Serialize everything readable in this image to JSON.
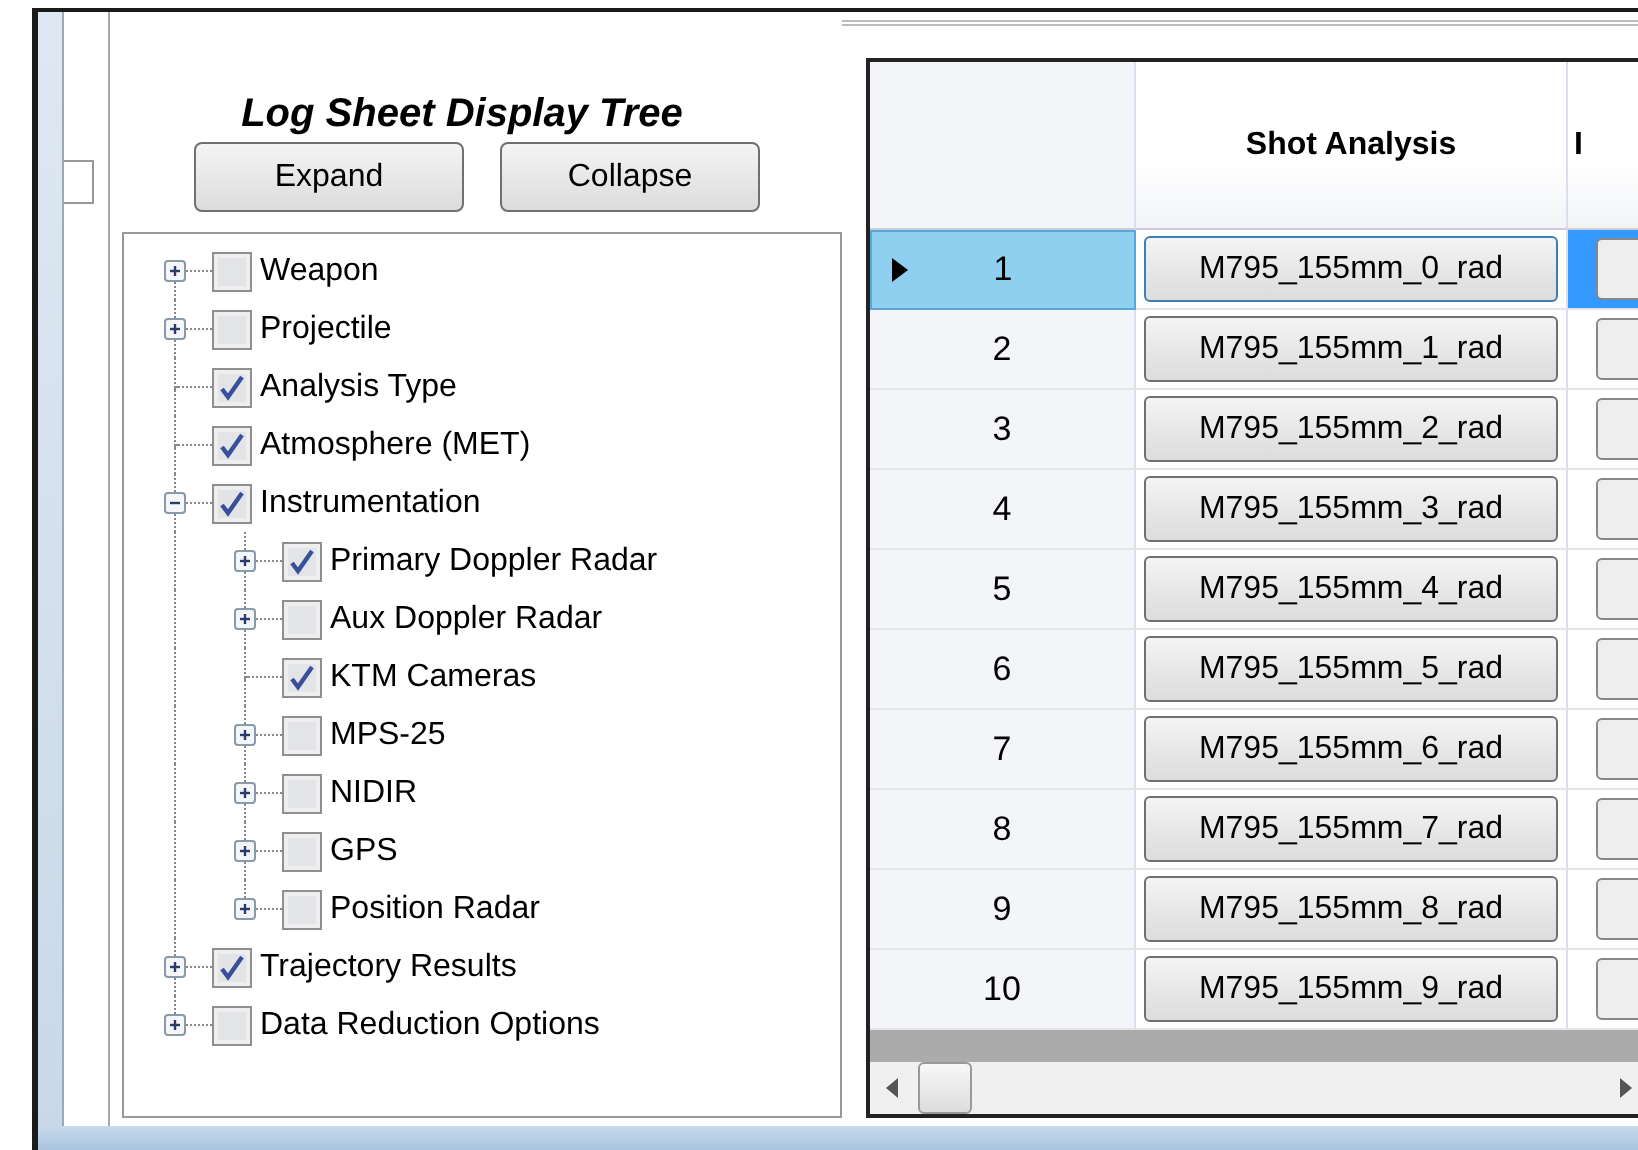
{
  "tree_panel": {
    "title": "Log Sheet Display Tree",
    "buttons": [
      "Expand",
      "Collapse"
    ],
    "tree": [
      {
        "label": "Weapon",
        "kind": "branch",
        "expanded": false,
        "checked": false
      },
      {
        "label": "Projectile",
        "kind": "branch",
        "expanded": false,
        "checked": false
      },
      {
        "label": "Analysis Type",
        "kind": "leaf",
        "checked": true
      },
      {
        "label": "Atmosphere (MET)",
        "kind": "leaf",
        "checked": true
      },
      {
        "label": "Instrumentation",
        "kind": "branch",
        "expanded": true,
        "checked": true,
        "children": [
          {
            "label": "Primary Doppler Radar",
            "kind": "branch",
            "expanded": false,
            "checked": true
          },
          {
            "label": "Aux Doppler Radar",
            "kind": "branch",
            "expanded": false,
            "checked": false
          },
          {
            "label": "KTM Cameras",
            "kind": "leaf",
            "checked": true
          },
          {
            "label": "MPS-25",
            "kind": "branch",
            "expanded": false,
            "checked": false
          },
          {
            "label": "NIDIR",
            "kind": "branch",
            "expanded": false,
            "checked": false
          },
          {
            "label": "GPS",
            "kind": "branch",
            "expanded": false,
            "checked": false
          },
          {
            "label": "Position Radar",
            "kind": "branch",
            "expanded": false,
            "checked": false
          }
        ]
      },
      {
        "label": "Trajectory Results",
        "kind": "branch",
        "expanded": false,
        "checked": true
      },
      {
        "label": "Data Reduction Options",
        "kind": "branch",
        "expanded": false,
        "checked": false
      }
    ]
  },
  "grid": {
    "columns": [
      "Shot Analysis",
      "I"
    ],
    "rows": [
      {
        "number": "1",
        "shot": "M795_155mm_0_rad",
        "selected": true
      },
      {
        "number": "2",
        "shot": "M795_155mm_1_rad",
        "selected": false
      },
      {
        "number": "3",
        "shot": "M795_155mm_2_rad",
        "selected": false
      },
      {
        "number": "4",
        "shot": "M795_155mm_3_rad",
        "selected": false
      },
      {
        "number": "5",
        "shot": "M795_155mm_4_rad",
        "selected": false
      },
      {
        "number": "6",
        "shot": "M795_155mm_5_rad",
        "selected": false
      },
      {
        "number": "7",
        "shot": "M795_155mm_6_rad",
        "selected": false
      },
      {
        "number": "8",
        "shot": "M795_155mm_7_rad",
        "selected": false
      },
      {
        "number": "9",
        "shot": "M795_155mm_8_rad",
        "selected": false
      },
      {
        "number": "10",
        "shot": "M795_155mm_9_rad",
        "selected": false
      }
    ]
  }
}
